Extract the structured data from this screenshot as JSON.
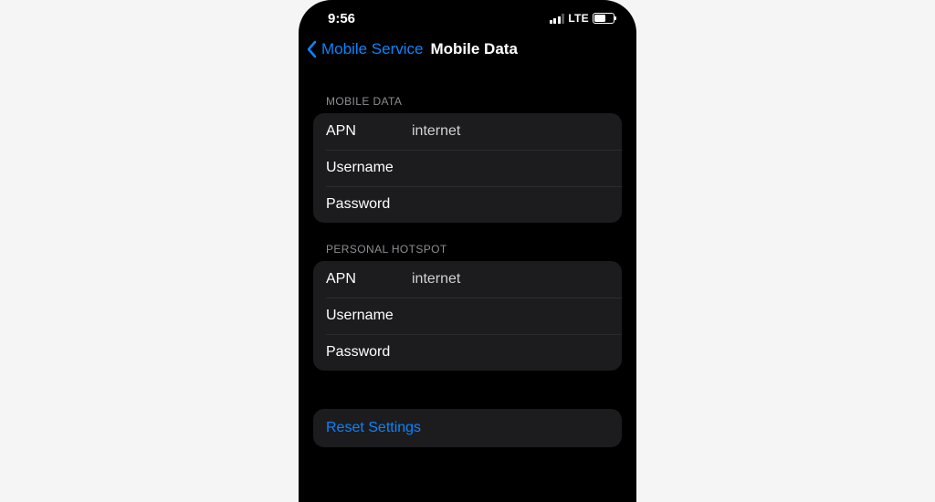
{
  "status": {
    "time": "9:56",
    "network": "LTE"
  },
  "nav": {
    "back_label": "Mobile Service",
    "title": "Mobile Data"
  },
  "sections": {
    "mobile_data": {
      "header": "MOBILE DATA",
      "apn_label": "APN",
      "apn_value": "internet",
      "username_label": "Username",
      "username_value": "",
      "password_label": "Password",
      "password_value": ""
    },
    "hotspot": {
      "header": "PERSONAL HOTSPOT",
      "apn_label": "APN",
      "apn_value": "internet",
      "username_label": "Username",
      "username_value": "",
      "password_label": "Password",
      "password_value": ""
    }
  },
  "actions": {
    "reset_label": "Reset Settings"
  },
  "colors": {
    "accent": "#0a84ff",
    "group_bg": "#1c1c1e",
    "secondary_text": "#8e8e93"
  }
}
